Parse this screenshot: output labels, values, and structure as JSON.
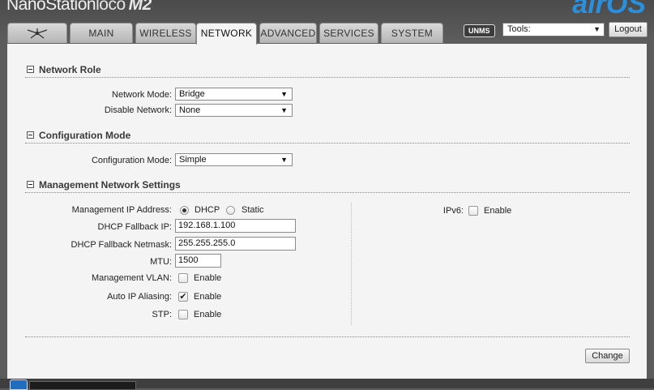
{
  "header": {
    "brand_main": "NanoStation",
    "brand_sub": "loco",
    "brand_model": "M2",
    "logo": "airOS"
  },
  "tabs": [
    {
      "label": "",
      "icon": "ubiquiti-logo-icon"
    },
    {
      "label": "MAIN"
    },
    {
      "label": "WIRELESS"
    },
    {
      "label": "NETWORK",
      "active": true
    },
    {
      "label": "ADVANCED"
    },
    {
      "label": "SERVICES"
    },
    {
      "label": "SYSTEM"
    }
  ],
  "toolbar": {
    "unms_badge": "UNMS",
    "tools_value": "Tools:",
    "logout_label": "Logout"
  },
  "network_role": {
    "title": "Network Role",
    "network_mode_label": "Network Mode:",
    "network_mode_value": "Bridge",
    "disable_network_label": "Disable Network:",
    "disable_network_value": "None"
  },
  "configuration_mode": {
    "title": "Configuration Mode",
    "label": "Configuration Mode:",
    "value": "Simple"
  },
  "management": {
    "title": "Management Network Settings",
    "ip_address_label": "Management IP Address:",
    "dhcp_label": "DHCP",
    "static_label": "Static",
    "ip_mode": "DHCP",
    "fallback_ip_label": "DHCP Fallback IP:",
    "fallback_ip_value": "192.168.1.100",
    "fallback_netmask_label": "DHCP Fallback Netmask:",
    "fallback_netmask_value": "255.255.255.0",
    "mtu_label": "MTU:",
    "mtu_value": "1500",
    "vlan_label": "Management VLAN:",
    "vlan_enable_label": "Enable",
    "vlan_enabled": false,
    "aliasing_label": "Auto IP Aliasing:",
    "aliasing_enable_label": "Enable",
    "aliasing_enabled": true,
    "stp_label": "STP:",
    "stp_enable_label": "Enable",
    "stp_enabled": false,
    "ipv6_label": "IPv6:",
    "ipv6_enable_label": "Enable",
    "ipv6_enabled": false
  },
  "actions": {
    "change_label": "Change"
  },
  "colors": {
    "accent": "#2a8fdc",
    "header_bg": "#5c5c5c",
    "panel_bg": "#f4f4f4"
  }
}
